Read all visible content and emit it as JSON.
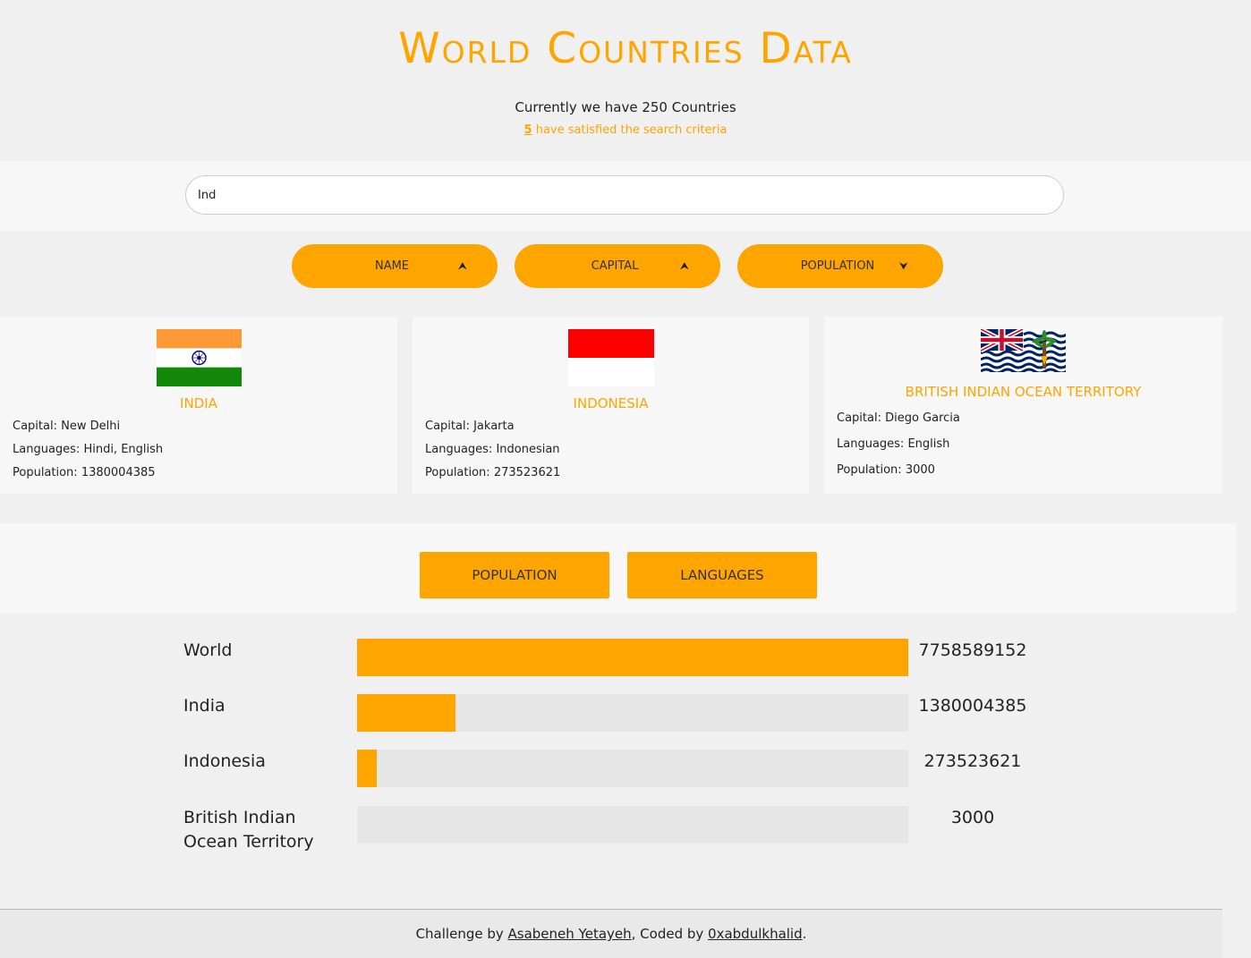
{
  "header": {
    "title": "World Countries Data",
    "subtitle": "Currently we have 250 Countries",
    "match_count": "5",
    "match_text": " have satisfied the search criteria"
  },
  "search": {
    "value": "Ind"
  },
  "sort_buttons": [
    {
      "label": "NAME",
      "arrow": "up"
    },
    {
      "label": "CAPITAL",
      "arrow": "up"
    },
    {
      "label": "POPULATION",
      "arrow": "down"
    }
  ],
  "countries": [
    {
      "name": "India",
      "capital": "Capital: New Delhi",
      "languages": "Languages: Hindi, English",
      "population": "Population: 1380004385",
      "flag": "india-flag"
    },
    {
      "name": "Indonesia",
      "capital": "Capital: Jakarta",
      "languages": "Languages: Indonesian",
      "population": "Population: 273523621",
      "flag": "indonesia-flag"
    },
    {
      "name": "British Indian Ocean Territory",
      "capital": "Capital: Diego Garcia",
      "languages": "Languages: English",
      "population": "Population: 3000",
      "flag": "biot-flag"
    }
  ],
  "tabs": [
    {
      "label": "POPULATION"
    },
    {
      "label": "LANGUAGES"
    }
  ],
  "stats": [
    {
      "label": "World",
      "value": "7758589152",
      "fraction": 1.0
    },
    {
      "label": "India",
      "value": "1380004385",
      "fraction": 0.1779
    },
    {
      "label": "Indonesia",
      "value": "273523621",
      "fraction": 0.0353
    },
    {
      "label": "British Indian Ocean Territory",
      "value": "3000",
      "fraction": 4e-07
    }
  ],
  "footer": {
    "prefix": "Challenge by ",
    "author": "Asabeneh Yetayeh",
    "middle": ", Coded by ",
    "coder": "0xabdulkhalid",
    "suffix": "."
  },
  "colors": {
    "accent": "#ffa500",
    "background": "#f0f0f0",
    "panel": "#f7f7f7",
    "bar_track": "#e6e6e6"
  }
}
